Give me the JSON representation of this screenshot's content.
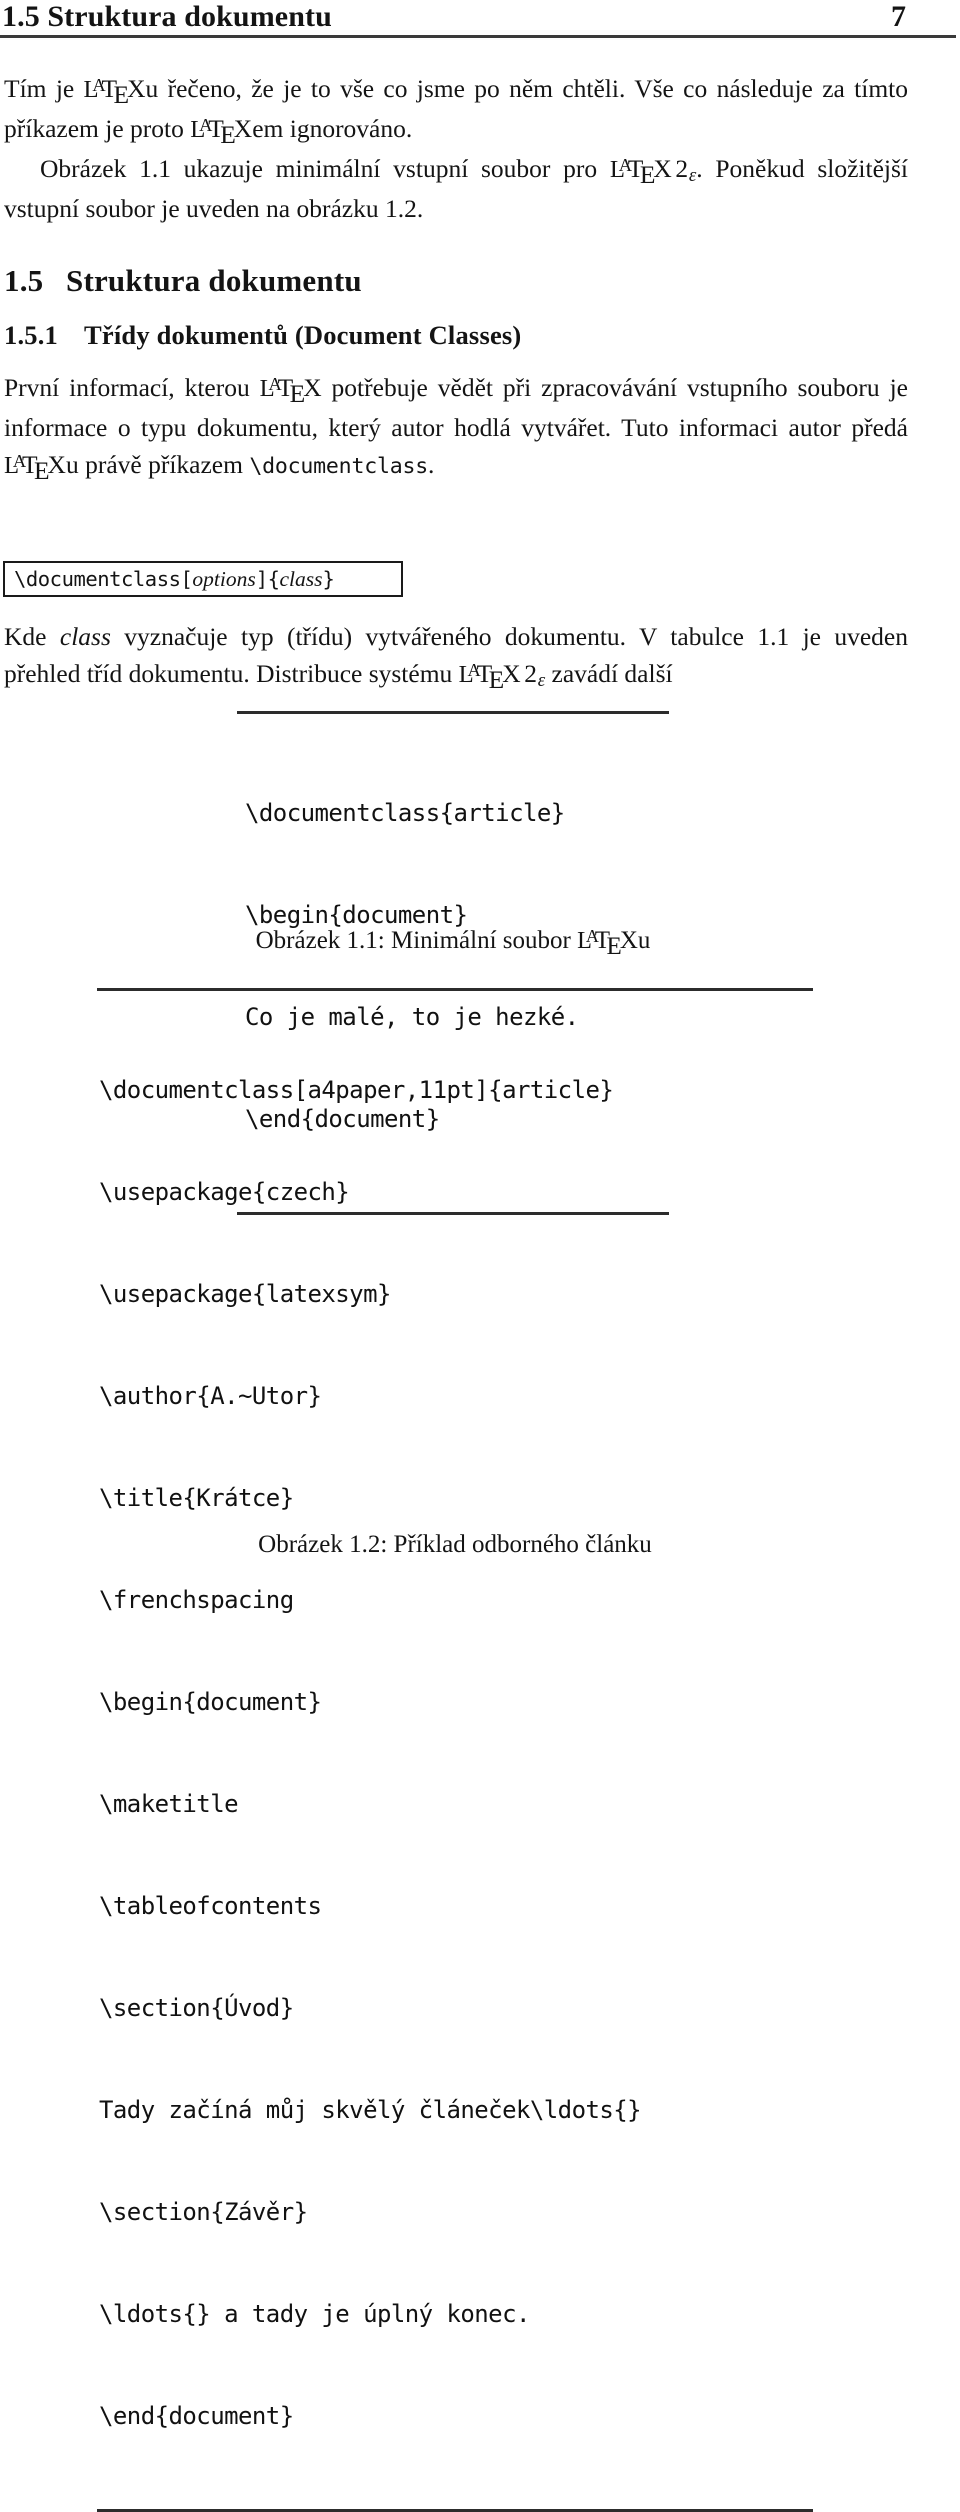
{
  "header": {
    "title": "1.5  Struktura dokumentu",
    "page_number": "7"
  },
  "paragraphs": {
    "p1_a": "Tím je ",
    "p1_b": "u řečeno, že je to vše co jsme po něm chtěli. Vše co následuje za tímto příkazem je proto ",
    "p1_c": "em ignorováno.",
    "p2_a": "Obrázek 1.1 ukazuje minimální vstupní soubor pro ",
    "p2_b": ". Poněkud složitější vstupní soubor je uveden na obrázku 1.2.",
    "p3_a": "První informací, kterou ",
    "p3_b": " potřebuje vědět při zpracovávání vstupního souboru je informace o typu dokumentu, který autor hodlá vytvářet. Tuto informaci autor předá ",
    "p3_c": "u právě příkazem ",
    "p3_cmd": "\\documentclass",
    "p3_d": ".",
    "p4_a": "Kde ",
    "p4_class": "class",
    "p4_b": " vyznačuje typ (třídu) vytvářeného dokumentu. V tabulce 1.1 je uveden přehled tříd dokumentu. Distribuce systému ",
    "p4_c": " zavádí další"
  },
  "section": {
    "number": "1.5",
    "title": "Struktura dokumentu"
  },
  "subsection": {
    "number": "1.5.1",
    "title": "Třídy dokumentů (Document Classes)"
  },
  "command_box": {
    "command": "\\documentclass[",
    "options": "options",
    "mid": "]{",
    "class": "class",
    "close": "}"
  },
  "figure_1_1": {
    "caption": "Obrázek 1.1: Minimální soubor ",
    "caption_suffix": "u",
    "lines": [
      "\\documentclass{article}",
      "\\begin{document}",
      "Co je malé, to je hezké.",
      "\\end{document}"
    ]
  },
  "figure_1_2": {
    "caption": "Obrázek 1.2: Příklad odborného článku",
    "lines": [
      "\\documentclass[a4paper,11pt]{article}",
      "\\usepackage{czech}",
      "\\usepackage{latexsym}",
      "\\author{A.~Utor}",
      "\\title{Krátce}",
      "\\frenchspacing",
      "\\begin{document}",
      "\\maketitle",
      "\\tableofcontents",
      "\\section{Úvod}",
      "Tady začíná můj skvělý článeček\\ldots{}",
      "\\section{Závěr}",
      "\\ldots{} a tady je úplný konec.",
      "\\end{document}"
    ]
  },
  "latex_logo": {
    "l": "L",
    "a": "A",
    "t": "T",
    "e": "E",
    "x": "X",
    "two": "2",
    "epsilon": "ε"
  },
  "colors": {
    "text": "#141414",
    "rule": "#3a3a3a",
    "background": "#ffffff"
  }
}
